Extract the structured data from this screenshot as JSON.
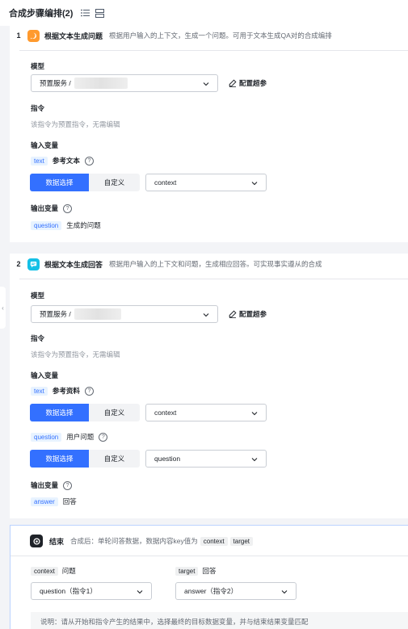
{
  "header": {
    "title": "合成步骤编排(2)",
    "list_icon": "list-icon",
    "layout_icon": "layout-icon"
  },
  "step1": {
    "number": "1",
    "title": "根据文本生成问题",
    "description": "根据用户输入的上下文，生成一个问题。可用于文本生成QA对的合成编排",
    "model_label": "模型",
    "model_value": "预置服务 /",
    "config_label": "配置超参",
    "instruction_label": "指令",
    "instruction_hint": "该指令为预置指令，无需编辑",
    "input_label": "输入变量",
    "input_var_tag": "text",
    "input_var_name": "参考文本",
    "seg_on": "数据选择",
    "seg_off": "自定义",
    "select_value": "context",
    "output_label": "输出变量",
    "output_var_tag": "question",
    "output_var_name": "生成的问题"
  },
  "step2": {
    "number": "2",
    "title": "根据文本生成回答",
    "description": "根据用户输入的上下文和问题，生成相应回答。可实现事实遵从的合成",
    "model_label": "模型",
    "model_value": "预置服务 /",
    "config_label": "配置超参",
    "instruction_label": "指令",
    "instruction_hint": "该指令为预置指令，无需编辑",
    "input_label": "输入变量",
    "input1_tag": "text",
    "input1_name": "参考资料",
    "seg1_on": "数据选择",
    "seg1_off": "自定义",
    "select1_value": "context",
    "input2_tag": "question",
    "input2_name": "用户问题",
    "seg2_on": "数据选择",
    "seg2_off": "自定义",
    "select2_value": "question",
    "output_label": "输出变量",
    "output_var_tag": "answer",
    "output_var_name": "回答"
  },
  "end": {
    "title": "结束",
    "desc": "合成后：单轮问答数据，数据内容key值为",
    "key1": "context",
    "key2": "target",
    "field1_tag": "context",
    "field1_name": "问题",
    "field1_value": "question（指令1）",
    "field2_tag": "target",
    "field2_name": "回答",
    "field2_value": "answer（指令2）",
    "note": "说明：请从开始和指令产生的结果中，选择最终的目标数据变量，并与结束结果变量匹配"
  },
  "colors": {
    "accent": "#3370ff",
    "step1_icon": "#ff9a2e",
    "step2_icon": "#14c0e6"
  }
}
